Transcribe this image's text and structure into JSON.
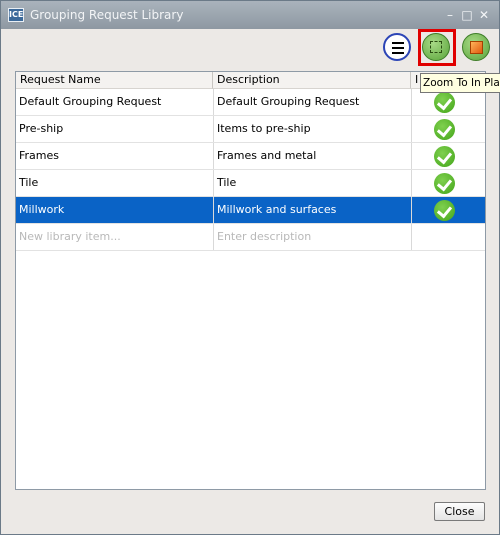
{
  "window": {
    "title": "Grouping Request Library",
    "app_icon_text": "ICE",
    "minimize_glyph": "–",
    "maximize_glyph": "□",
    "close_glyph": "✕"
  },
  "toolbar": {
    "menu_icon": "hamburger-menu-icon",
    "zoom_icon": "zoom-to-in-plan-icon",
    "cube_icon": "3d-cube-icon",
    "tooltip": "Zoom To In Plan"
  },
  "table": {
    "columns": [
      "Request Name",
      "Description",
      "I"
    ],
    "rows": [
      {
        "name": "Default Grouping Request",
        "description": "Default Grouping Request",
        "included": true
      },
      {
        "name": "Pre-ship",
        "description": "Items to pre-ship",
        "included": true
      },
      {
        "name": "Frames",
        "description": "Frames and metal",
        "included": true
      },
      {
        "name": "Tile",
        "description": "Tile",
        "included": true
      },
      {
        "name": "Millwork",
        "description": "Millwork and surfaces",
        "included": true,
        "selected": true
      }
    ],
    "new_row": {
      "name_placeholder": "New library item...",
      "description_placeholder": "Enter description"
    }
  },
  "footer": {
    "close_label": "Close"
  },
  "colors": {
    "selection": "#0a63c6",
    "highlight_border": "#e00000",
    "check_green": "#43a519"
  }
}
